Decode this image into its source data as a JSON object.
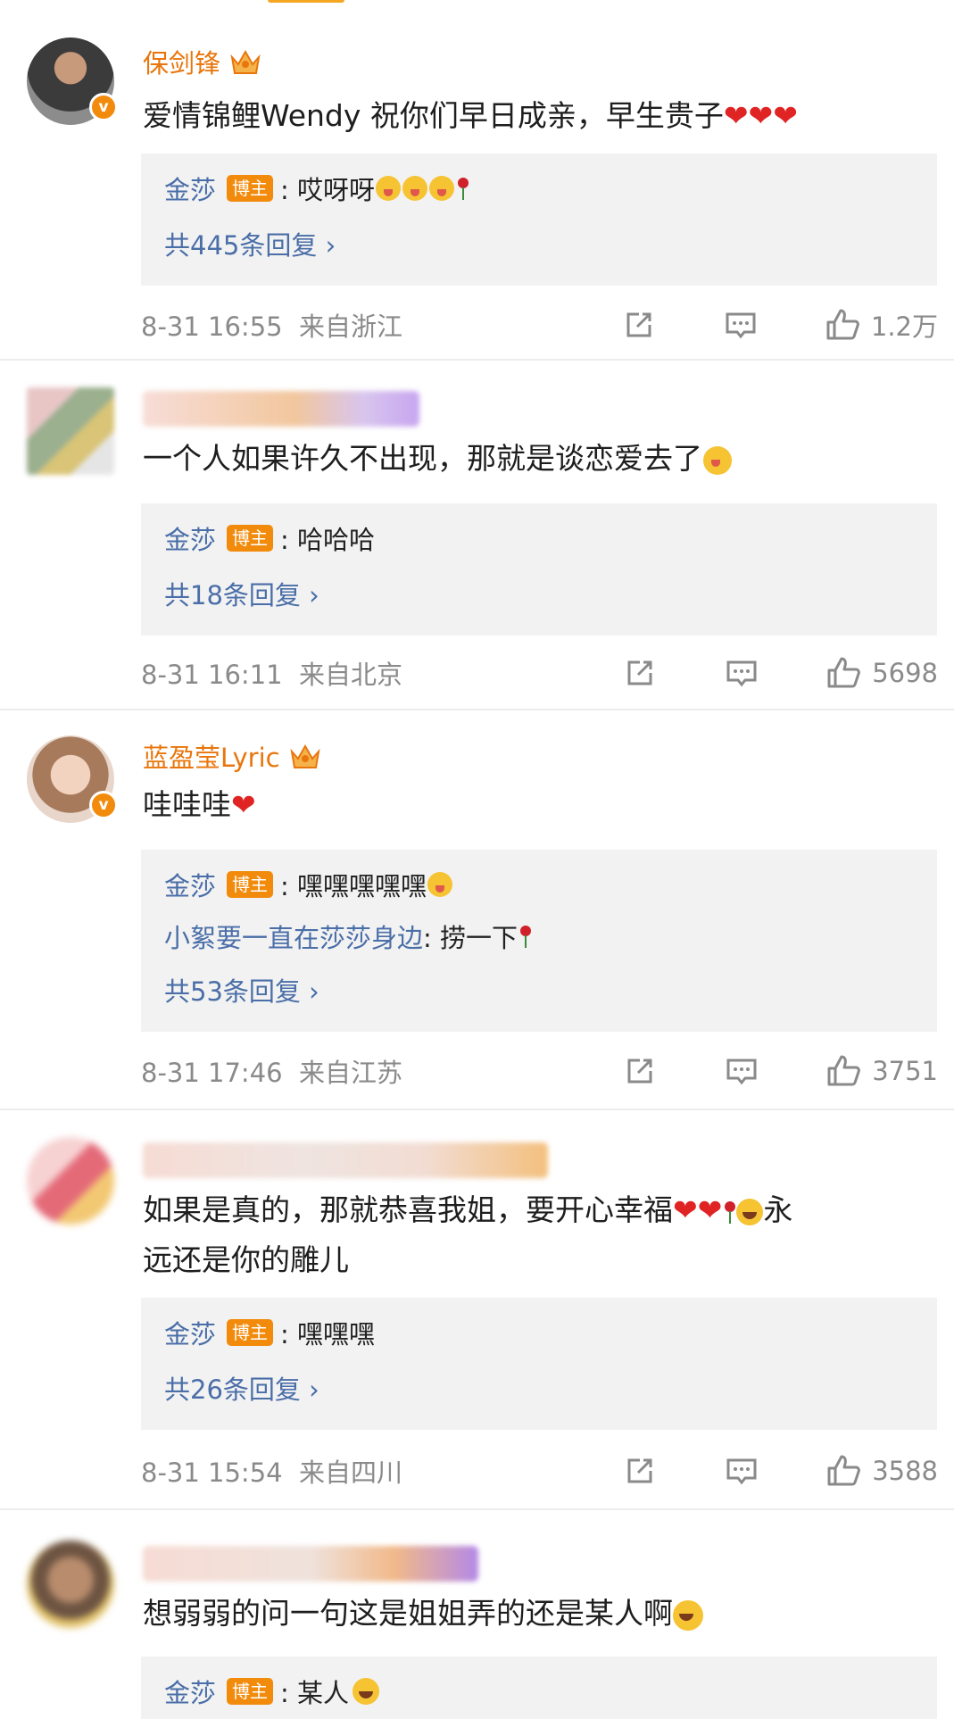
{
  "comments": [
    {
      "name": "保剑锋",
      "text": "爱情锦鲤Wendy 祝你们早日成亲，早生贵子",
      "replies": [
        {
          "name": "金莎",
          "tag": "博主",
          "text": ": 哎呀呀"
        }
      ],
      "more": "共445条回复 ›",
      "time": "8-31 16:55",
      "location": "来自浙江",
      "likes": "1.2万"
    },
    {
      "name": "",
      "text": "一个人如果许久不出现，那就是谈恋爱去了",
      "replies": [
        {
          "name": "金莎",
          "tag": "博主",
          "text": ": 哈哈哈"
        }
      ],
      "more": "共18条回复 ›",
      "time": "8-31 16:11",
      "location": "来自北京",
      "likes": "5698"
    },
    {
      "name": "蓝盈莹Lyric",
      "text": "哇哇哇",
      "replies": [
        {
          "name": "金莎",
          "tag": "博主",
          "text": ": 嘿嘿嘿嘿嘿"
        },
        {
          "name": "小絮要一直在莎莎身边",
          "tag": "",
          "text": ": 捞一下"
        }
      ],
      "more": "共53条回复 ›",
      "time": "8-31 17:46",
      "location": "来自江苏",
      "likes": "3751"
    },
    {
      "name": "",
      "text_line1": "如果是真的，那就恭喜我姐，要开心幸福",
      "text_line1_tail": "永",
      "text_line2": "远还是你的雕儿",
      "replies": [
        {
          "name": "金莎",
          "tag": "博主",
          "text": ": 嘿嘿嘿"
        }
      ],
      "more": "共26条回复 ›",
      "time": "8-31 15:54",
      "location": "来自四川",
      "likes": "3588"
    },
    {
      "name": "",
      "text": "想弱弱的问一句这是姐姐弄的还是某人啊",
      "replies": [
        {
          "name": "金莎",
          "tag": "博主",
          "text": ": 某人"
        }
      ]
    }
  ],
  "colors": {
    "username": "#e8760c",
    "reply_name": "#4a6ea8",
    "tag_bg": "#f28b0c",
    "reply_bg": "#f2f2f2",
    "meta": "#8a8a8a"
  }
}
